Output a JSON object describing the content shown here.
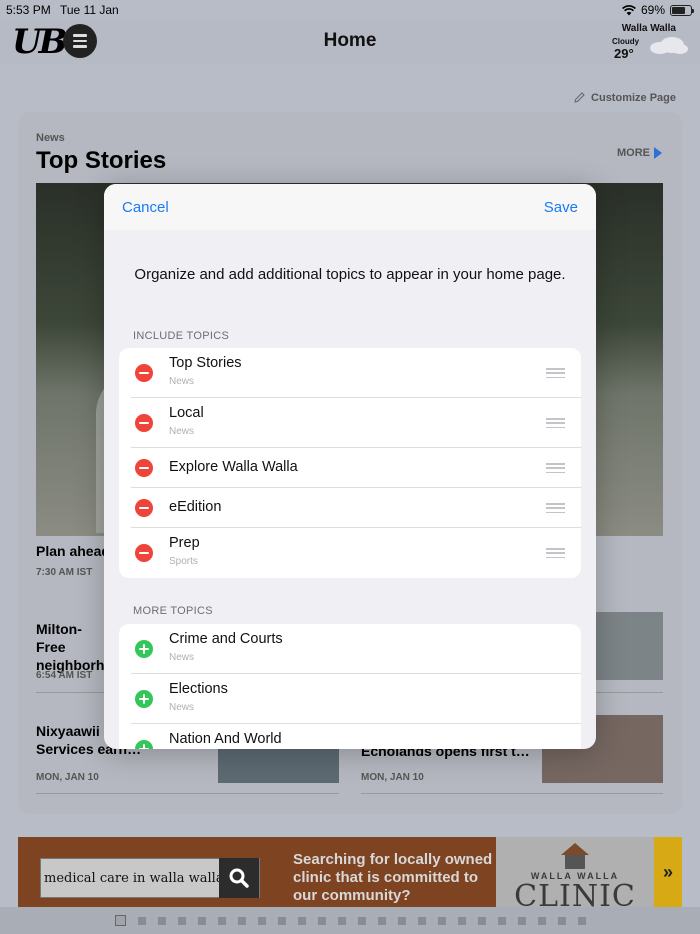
{
  "status": {
    "time": "5:53 PM",
    "date": "Tue 11 Jan",
    "battery": "69%",
    "battery_level": 0.69
  },
  "header": {
    "logo": "UB",
    "title": "Home",
    "weather": {
      "city": "Walla Walla",
      "condition": "Cloudy",
      "temp": "29°"
    }
  },
  "page": {
    "customize_label": "Customize Page",
    "card": {
      "section": "News",
      "title": "Top Stories",
      "more_label": "MORE"
    },
    "stories": [
      {
        "title": "Plan ahead",
        "time": "7:30 AM IST"
      },
      {
        "title": "Milton-Free neighborhood",
        "time": "6:54 AM IST"
      },
      {
        "title": "Nixyaawii Financial Services earn…",
        "time": "MON, JAN 10"
      },
      {
        "title": "Echolands opens first t…",
        "time": "MON, JAN 10"
      }
    ]
  },
  "modal": {
    "cancel_label": "Cancel",
    "save_label": "Save",
    "intro": "Organize and add additional topics to appear in your home page.",
    "include_label": "INCLUDE TOPICS",
    "include_topics": [
      {
        "title": "Top Stories",
        "sub": "News"
      },
      {
        "title": "Local",
        "sub": "News"
      },
      {
        "title": "Explore Walla Walla",
        "sub": ""
      },
      {
        "title": "eEdition",
        "sub": ""
      },
      {
        "title": "Prep",
        "sub": "Sports"
      }
    ],
    "more_label": "MORE TOPICS",
    "more_topics": [
      {
        "title": "Crime and Courts",
        "sub": "News"
      },
      {
        "title": "Elections",
        "sub": "News"
      },
      {
        "title": "Nation And World",
        "sub": ""
      }
    ]
  },
  "ad": {
    "search_text": "medical care in walla walla",
    "tagline": "Searching for locally owned clinic that is committed to our community?",
    "brand_small": "WALLA WALLA",
    "brand_big": "CLINIC",
    "arrow": "»"
  },
  "colors": {
    "accent": "#1a7bf5",
    "remove": "#f0433a",
    "add": "#33c659"
  }
}
